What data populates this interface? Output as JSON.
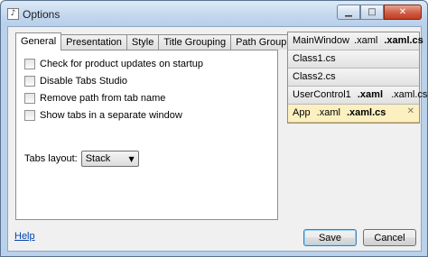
{
  "window": {
    "title": "Options"
  },
  "tabs": [
    {
      "label": "General",
      "active": true
    },
    {
      "label": "Presentation",
      "active": false
    },
    {
      "label": "Style",
      "active": false
    },
    {
      "label": "Title Grouping",
      "active": false
    },
    {
      "label": "Path Grouping",
      "active": false
    }
  ],
  "general": {
    "options": [
      {
        "label": "Check for product updates on startup",
        "checked": false
      },
      {
        "label": "Disable Tabs Studio",
        "checked": false
      },
      {
        "label": "Remove path from tab name",
        "checked": false
      },
      {
        "label": "Show tabs in a separate window",
        "checked": false
      }
    ],
    "layout_label": "Tabs layout:",
    "layout_value": "Stack"
  },
  "preview_tabs": {
    "mainwindow": {
      "name": "MainWindow",
      "ext1": ".xaml",
      "ext2": ".xaml.cs"
    },
    "class1": {
      "name": "Class1.cs"
    },
    "class2": {
      "name": "Class2.cs"
    },
    "usercontrol": {
      "name": "UserControl1",
      "ext1": ".xaml",
      "ext2": ".xaml.cs"
    },
    "app": {
      "name": "App",
      "ext1": ".xaml",
      "ext2": ".xaml.cs"
    }
  },
  "footer": {
    "help": "Help",
    "save": "Save",
    "cancel": "Cancel"
  }
}
